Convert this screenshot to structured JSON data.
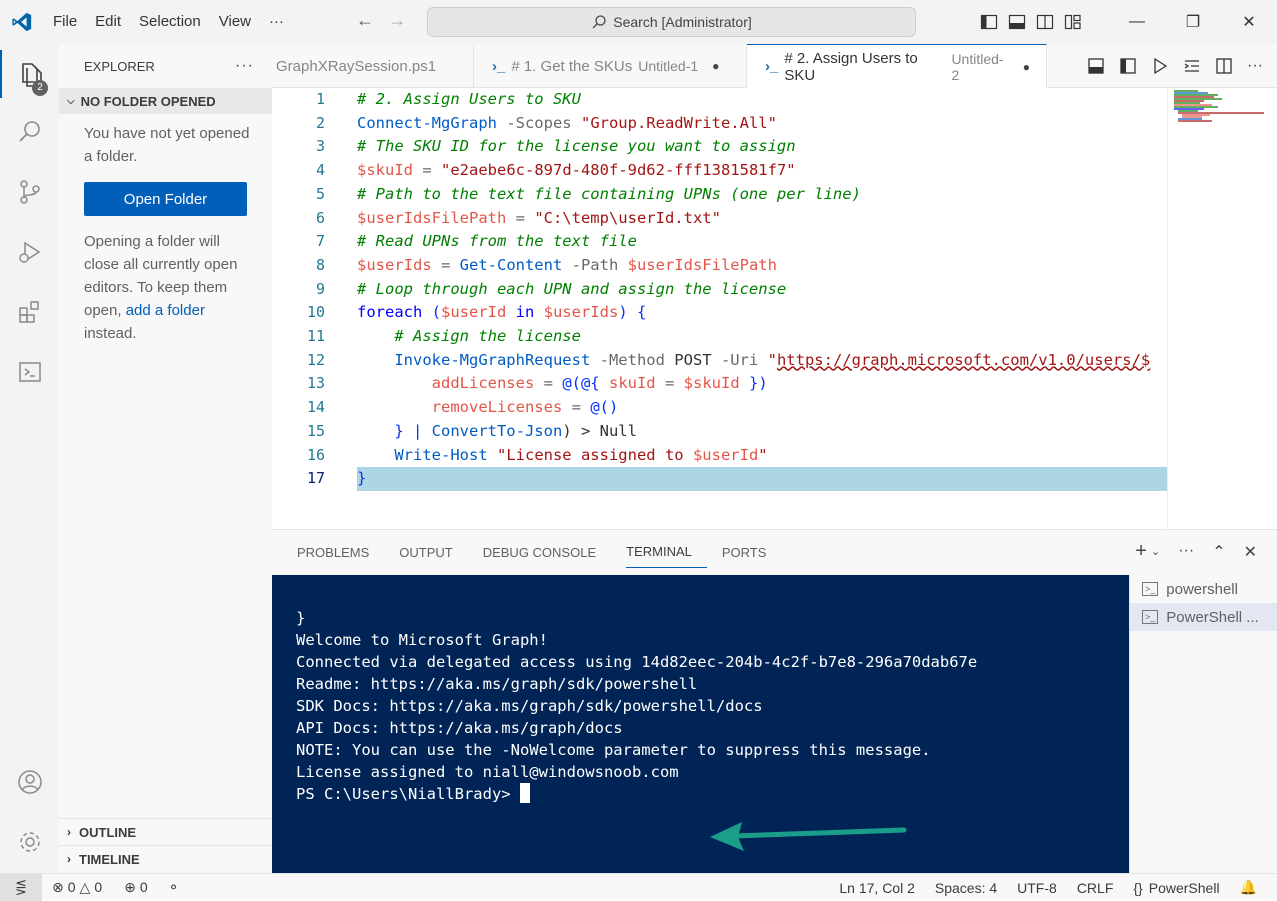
{
  "titlebar": {
    "menu": [
      "File",
      "Edit",
      "Selection",
      "View",
      "···"
    ],
    "search_text": "Search [Administrator]",
    "brand_color": "#0065a9"
  },
  "activitybar": {
    "explorer_badge": "2",
    "icons": [
      "files-icon",
      "search-icon",
      "source-control-icon",
      "run-debug-icon",
      "extensions-icon",
      "remote-explorer-icon",
      "account-icon",
      "settings-gear-icon"
    ]
  },
  "sidebar": {
    "title": "EXPLORER",
    "more": "···",
    "section": "NO FOLDER OPENED",
    "message": "You have not yet opened a folder.",
    "open_folder_label": "Open Folder",
    "hint_prefix": "Opening a folder will close all currently open editors. To keep them open, ",
    "hint_link": "add a folder",
    "hint_suffix": " instead.",
    "outline": "OUTLINE",
    "timeline": "TIMELINE"
  },
  "tabs": [
    {
      "label": "GraphXRaySession.ps1",
      "desc": "",
      "active": false
    },
    {
      "label": "# 1. Get the SKUs",
      "desc": "Untitled-1",
      "active": false
    },
    {
      "label": "# 2. Assign Users to SKU",
      "desc": "Untitled-2",
      "active": true
    }
  ],
  "editor": {
    "line_numbers": [
      "1",
      "2",
      "3",
      "4",
      "5",
      "6",
      "7",
      "8",
      "9",
      "10",
      "11",
      "12",
      "13",
      "14",
      "15",
      "16",
      "17"
    ],
    "code": {
      "l1": "# 2. Assign Users to SKU",
      "l2_cmd": "Connect-MgGraph",
      "l2_par": " -Scopes ",
      "l2_str": "\"Group.ReadWrite.All\"",
      "l3": "# The SKU ID for the license you want to assign",
      "l4_var": "$skuId",
      "l4_op": " = ",
      "l4_str": "\"e2aebe6c-897d-480f-9d62-fff1381581f7\"",
      "l5": "# Path to the text file containing UPNs (one per line)",
      "l6_var": "$userIdsFilePath",
      "l6_op": " = ",
      "l6_str": "\"C:\\temp\\userId.txt\"",
      "l7": "# Read UPNs from the text file",
      "l8_var": "$userIds",
      "l8_op": " = ",
      "l8_cmd": "Get-Content",
      "l8_par": " -Path ",
      "l8_var2": "$userIdsFilePath",
      "l9": "# Loop through each UPN and assign the license",
      "l10_kw": "foreach",
      "l10_p1": " (",
      "l10_var": "$userId",
      "l10_in": " in ",
      "l10_var2": "$userIds",
      "l10_p2": ") {",
      "l11": "    # Assign the license",
      "l12_ind": "    ",
      "l12_cmd": "Invoke-MgGraphRequest",
      "l12_par": " -Method ",
      "l12_plain": "POST",
      "l12_par2": " -Uri ",
      "l12_str": "\"",
      "l12_url": "https://graph.microsoft.com/v1.0/users/$",
      "l13_ind": "        ",
      "l13_key": "addLicenses",
      "l13_op": " = ",
      "l13_a": "@(@{ ",
      "l13_key2": "skuId",
      "l13_op2": " = ",
      "l13_var": "$skuId",
      "l13_b": " })",
      "l14_ind": "        ",
      "l14_key": "removeLicenses",
      "l14_op": " = ",
      "l14_a": "@()",
      "l15_ind": "    ",
      "l15_a": "} | ",
      "l15_cmd": "ConvertTo-Json",
      "l15_b": ") > Null",
      "l16_ind": "    ",
      "l16_cmd": "Write-Host",
      "l16_str": " \"License assigned to ",
      "l16_var": "$userId",
      "l16_str2": "\"",
      "l17": "}"
    }
  },
  "panel": {
    "tabs": [
      "PROBLEMS",
      "OUTPUT",
      "DEBUG CONSOLE",
      "TERMINAL",
      "PORTS"
    ],
    "active_tab": "TERMINAL",
    "terminal_lines": [
      "}",
      "Welcome to Microsoft Graph!",
      "",
      "Connected via delegated access using 14d82eec-204b-4c2f-b7e8-296a70dab67e",
      "Readme: https://aka.ms/graph/sdk/powershell",
      "SDK Docs: https://aka.ms/graph/sdk/powershell/docs",
      "API Docs: https://aka.ms/graph/docs",
      "",
      "NOTE: You can use the -NoWelcome parameter to suppress this message.",
      "",
      "License assigned to niall@windowsnoob.com"
    ],
    "prompt": "PS C:\\Users\\NiallBrady> ",
    "terminals": [
      "powershell",
      "PowerShell ..."
    ],
    "arrow_color": "#1a9e8a",
    "terminal_bg": "#012456"
  },
  "statusbar": {
    "errors": "0",
    "warnings": "0",
    "ports": "0",
    "position": "Ln 17, Col 2",
    "spaces": "Spaces: 4",
    "encoding": "UTF-8",
    "eol": "CRLF",
    "language": "PowerShell"
  }
}
